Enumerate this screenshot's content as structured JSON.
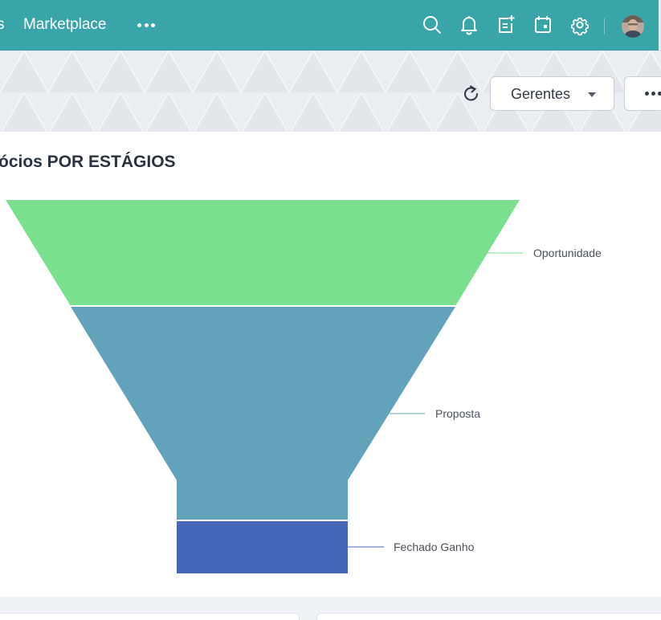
{
  "topbar": {
    "nav_fragment": "s",
    "nav_marketplace": "Marketplace",
    "icons": [
      "more-horizontal-icon",
      "search-icon",
      "bell-icon",
      "add-note-icon",
      "calendar-icon",
      "gear-icon",
      "avatar"
    ]
  },
  "toolbar": {
    "refresh_icon": "refresh-icon",
    "filter_label": "Gerentes",
    "more_icon": "more-horizontal-icon"
  },
  "card": {
    "title": "ócios POR ESTÁGIOS"
  },
  "chart_data": {
    "type": "funnel",
    "title": "ócios POR ESTÁGIOS",
    "stages": [
      {
        "name": "Oportunidade",
        "color": "#7ae08f"
      },
      {
        "name": "Proposta",
        "color": "#62a3bb"
      },
      {
        "name": "Fechado Ganho",
        "color": "#4666b9"
      }
    ]
  },
  "colors": {
    "topbar": "#3aa5a8",
    "band": "#e6eaef",
    "card": "#ffffff"
  }
}
